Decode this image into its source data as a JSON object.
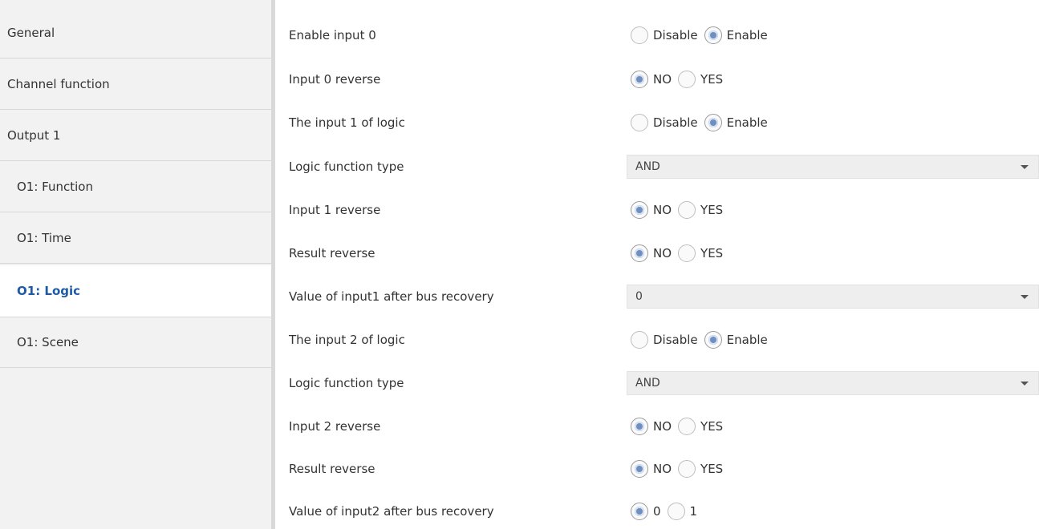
{
  "sidebar": {
    "items": [
      {
        "label": "General"
      },
      {
        "label": "Channel function"
      },
      {
        "label": "Output 1"
      },
      {
        "label": "O1: Function"
      },
      {
        "label": "O1: Time"
      },
      {
        "label": "O1: Logic",
        "active": true
      },
      {
        "label": "O1: Scene"
      }
    ]
  },
  "params": [
    {
      "label": "Enable input 0",
      "type": "radio",
      "options": [
        "Disable",
        "Enable"
      ],
      "selected": "Enable"
    },
    {
      "label": "Input 0 reverse",
      "type": "radio",
      "options": [
        "NO",
        "YES"
      ],
      "selected": "NO"
    },
    {
      "label": "The input 1 of logic",
      "type": "radio",
      "options": [
        "Disable",
        "Enable"
      ],
      "selected": "Enable"
    },
    {
      "label": "Logic function type",
      "type": "select",
      "value": "AND"
    },
    {
      "label": "Input 1 reverse",
      "type": "radio",
      "options": [
        "NO",
        "YES"
      ],
      "selected": "NO"
    },
    {
      "label": "Result reverse",
      "type": "radio",
      "options": [
        "NO",
        "YES"
      ],
      "selected": "NO"
    },
    {
      "label": "Value of input1 after bus recovery",
      "type": "select",
      "value": "0"
    },
    {
      "label": "The input 2 of logic",
      "type": "radio",
      "options": [
        "Disable",
        "Enable"
      ],
      "selected": "Enable"
    },
    {
      "label": "Logic function type",
      "type": "select",
      "value": "AND"
    },
    {
      "label": "Input 2 reverse",
      "type": "radio",
      "options": [
        "NO",
        "YES"
      ],
      "selected": "NO"
    },
    {
      "label": "Result reverse",
      "type": "radio",
      "options": [
        "NO",
        "YES"
      ],
      "selected": "NO"
    },
    {
      "label": "Value of input2 after bus recovery",
      "type": "radio",
      "options": [
        "0",
        "1"
      ],
      "selected": "0"
    }
  ],
  "colors": {
    "accent": "#1f5aa6",
    "radio_selected": "#6f8fbf",
    "sidebar_bg": "#f2f2f2"
  }
}
